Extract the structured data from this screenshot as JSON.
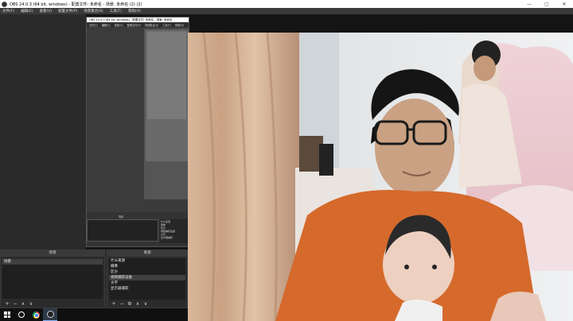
{
  "window": {
    "title": "OBS 24.0.3 (64 bit, windows) - 配置文件: 未命名 - 场景: 未命名 (2) (2)",
    "buttons": [
      "—",
      "▢",
      "✕"
    ]
  },
  "menubar": {
    "items": [
      "文件(F)",
      "编辑(E)",
      "查看(V)",
      "配置文件(P)",
      "场景集合(S)",
      "工具(T)",
      "帮助(H)"
    ]
  },
  "nested_window": {
    "title": "OBS 24.0.3 (64 bit, windows) - 配置文件: 未命名 - 场景: 未命名",
    "menu": [
      "文件(F)",
      "编辑(E)",
      "查看(V)",
      "配置文件(P)",
      "场景集合(S)",
      "工具(T)",
      "帮助(H)"
    ],
    "dock_label": "场景",
    "sources_items": [
      "什么来源",
      "摄像",
      "区分",
      "视频捕获设备",
      "文字",
      "显示器捕获"
    ]
  },
  "scenes_dock": {
    "title": "场景",
    "items": [
      "场景"
    ],
    "toolbar": [
      "+",
      "−",
      "∧",
      "∨"
    ]
  },
  "sources_dock": {
    "title": "来源",
    "items": [
      "什么来源",
      "摄像",
      "区分",
      "视频捕获设备",
      "文字",
      "显示器捕获"
    ],
    "toolbar": [
      "+",
      "−",
      "⚙",
      "∧",
      "∨"
    ]
  },
  "taskbar": {
    "icons": [
      "windows-start-icon",
      "cortana-icon",
      "chrome-icon",
      "obs-icon"
    ]
  }
}
